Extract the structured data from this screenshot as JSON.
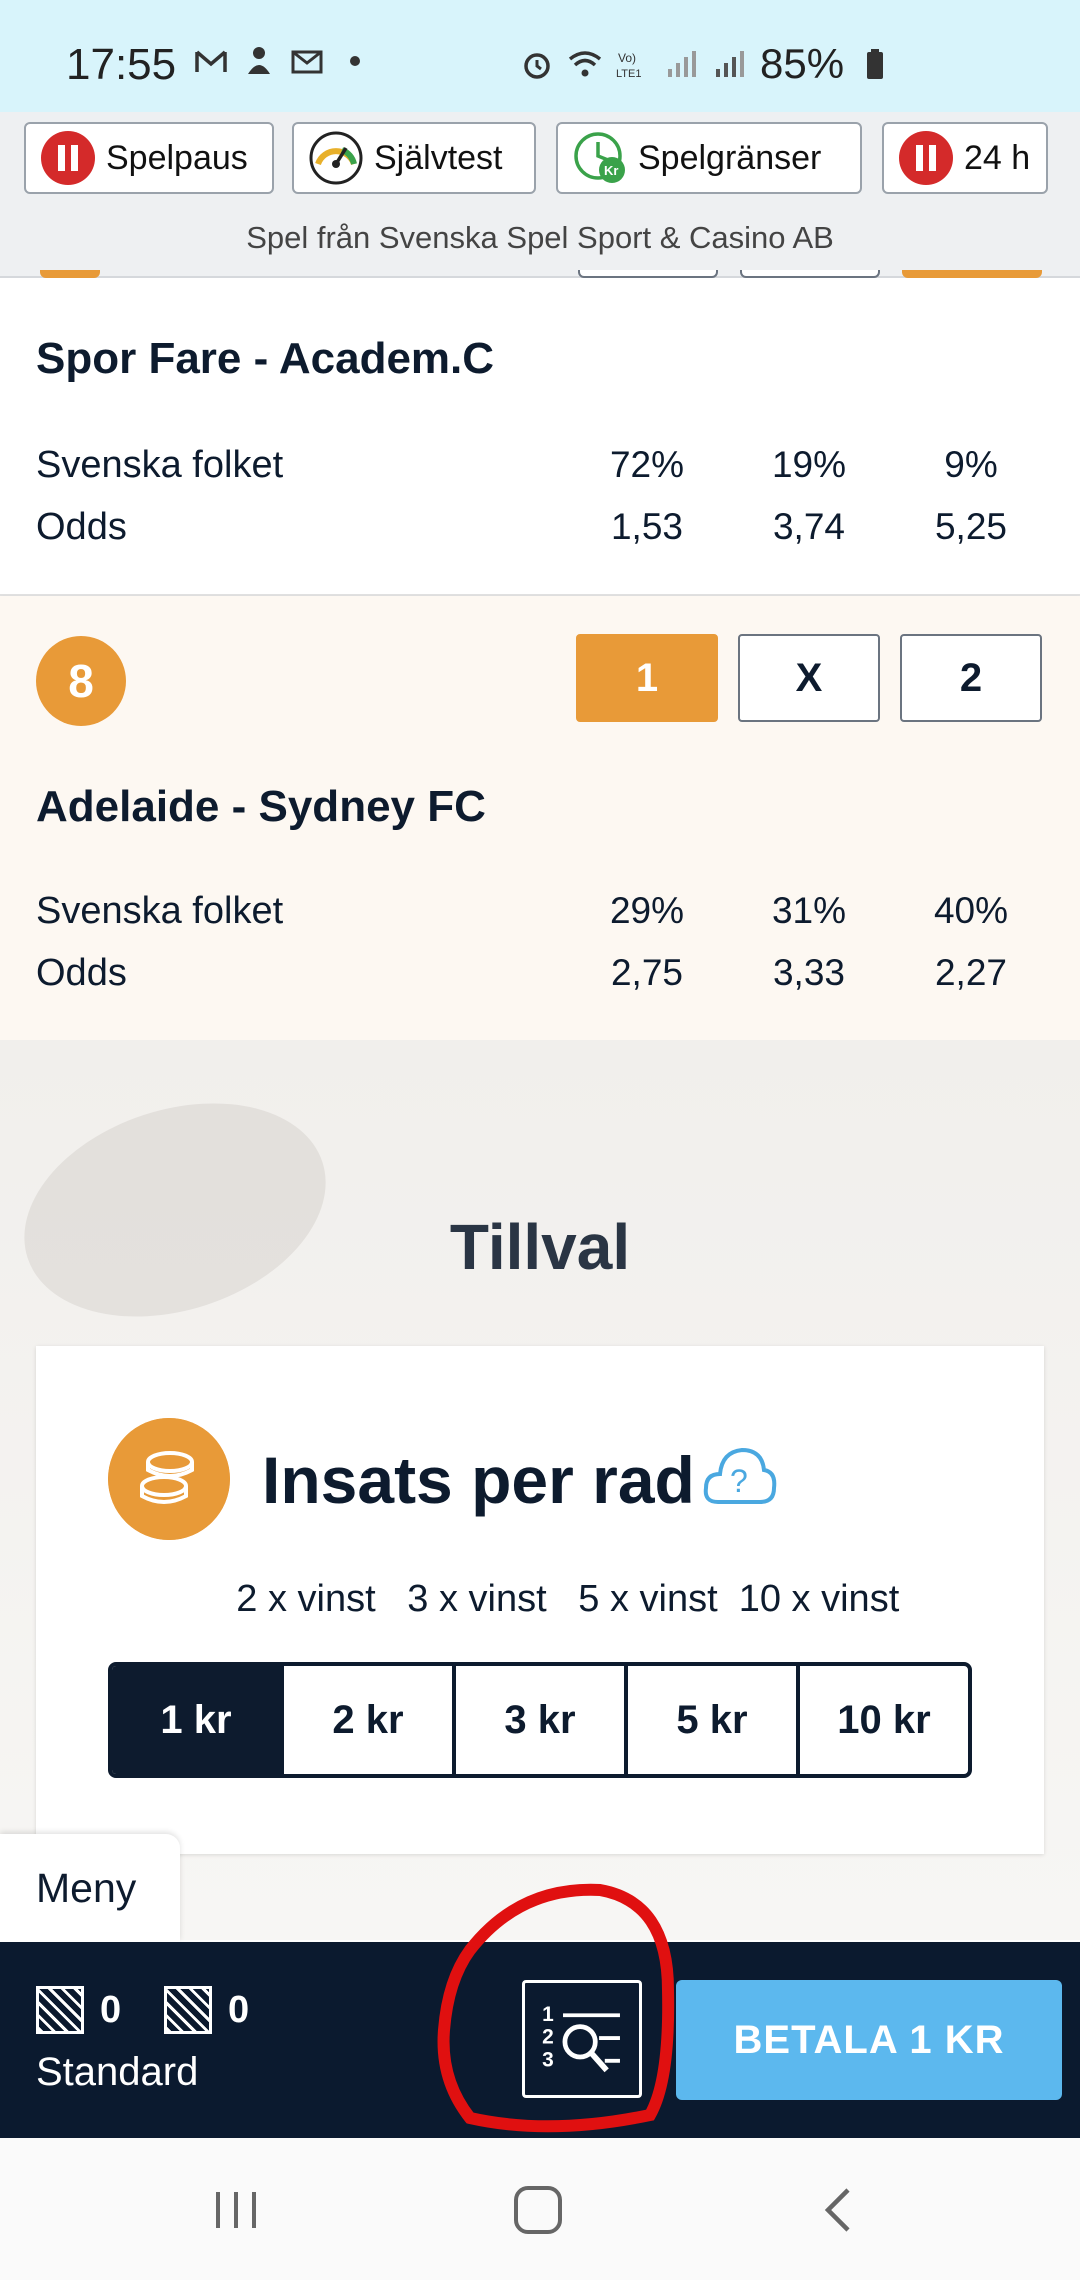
{
  "status_bar": {
    "time": "17:55",
    "battery": "85%",
    "icons": [
      "gmail-icon",
      "notification-icon",
      "outlook-icon",
      "dot-icon",
      "alarm-icon",
      "wifi-icon",
      "volte-icon",
      "signal-icon",
      "battery-icon"
    ]
  },
  "responsible_gaming": {
    "buttons": [
      {
        "label": "Spelpaus",
        "icon": "pause-icon"
      },
      {
        "label": "Självtest",
        "icon": "gauge-icon"
      },
      {
        "label": "Spelgränser",
        "icon": "clock-kr-icon"
      },
      {
        "label": "24 h",
        "icon": "pause-icon"
      }
    ],
    "caption": "Spel från Svenska Spel Sport & Casino AB"
  },
  "matches": [
    {
      "title": "Spor Fare - Academ.C",
      "rows": [
        {
          "label": "Svenska folket",
          "values": [
            "72%",
            "19%",
            "9%"
          ]
        },
        {
          "label": "Odds",
          "values": [
            "1,53",
            "3,74",
            "5,25"
          ]
        }
      ]
    },
    {
      "number": "8",
      "picks": [
        "1",
        "X",
        "2"
      ],
      "selected": "1",
      "title": "Adelaide - Sydney FC",
      "rows": [
        {
          "label": "Svenska folket",
          "values": [
            "29%",
            "31%",
            "40%"
          ]
        },
        {
          "label": "Odds",
          "values": [
            "2,75",
            "3,33",
            "2,27"
          ]
        }
      ]
    }
  ],
  "tillval": {
    "heading": "Tillval",
    "card_title": "Insats per rad",
    "multipliers": [
      "2 x vinst",
      "3 x vinst",
      "5 x vinst",
      "10 x vinst"
    ],
    "stakes": [
      "1 kr",
      "2 kr",
      "3 kr",
      "5 kr",
      "10 kr"
    ],
    "selected_stake": "1 kr"
  },
  "menu_tab": "Meny",
  "bottom_bar": {
    "count_a": "0",
    "count_b": "0",
    "system_label": "Standard",
    "pay_button": "BETALA 1 KR"
  },
  "colors": {
    "accent_orange": "#e89a38",
    "navy": "#0b1a2f",
    "pay_blue": "#5cb8ee",
    "highlight_red": "#e01010"
  }
}
